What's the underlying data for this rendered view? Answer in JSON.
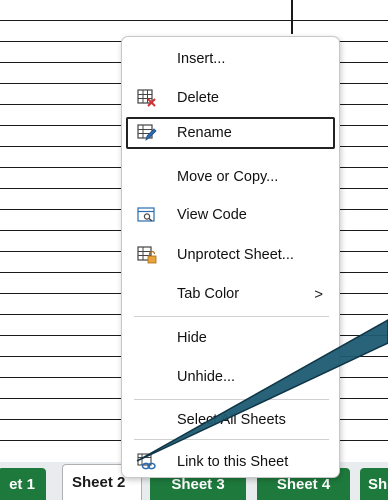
{
  "context_menu": {
    "items": [
      {
        "label": "Insert...",
        "icon": ""
      },
      {
        "label": "Delete",
        "icon": "delete-sheet-icon"
      },
      {
        "label": "Rename",
        "icon": "rename-sheet-icon"
      },
      {
        "label": "Move or Copy...",
        "icon": ""
      },
      {
        "label": "View Code",
        "icon": "view-code-icon"
      },
      {
        "label": "Unprotect Sheet...",
        "icon": "unprotect-sheet-icon"
      },
      {
        "label": "Tab Color",
        "icon": ""
      },
      {
        "label": "Hide",
        "icon": ""
      },
      {
        "label": "Unhide...",
        "icon": ""
      },
      {
        "label": "Select All Sheets",
        "icon": ""
      },
      {
        "label": "Link to this Sheet",
        "icon": "link-icon"
      }
    ],
    "submenu_arrow": ">",
    "highlighted": "Rename"
  },
  "tabs": [
    {
      "label": "et 1"
    },
    {
      "label": "Sheet 2"
    },
    {
      "label": "Sheet 3"
    },
    {
      "label": "Sheet 4"
    },
    {
      "label": "Sh"
    }
  ],
  "colors": {
    "tab_green": "#1e7a3c",
    "callout_fill": "#1e5b73",
    "accent_blue": "#2b6cb0"
  }
}
